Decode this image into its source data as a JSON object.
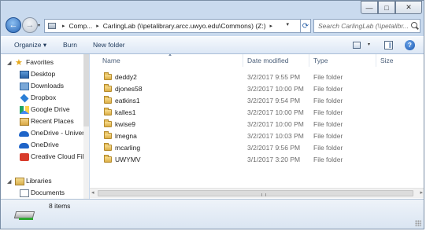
{
  "window": {
    "minimize_glyph": "—",
    "maximize_glyph": "□",
    "close_glyph": "✕"
  },
  "navigation": {
    "back_glyph": "←",
    "forward_glyph": "→",
    "address_segments": [
      "Comp...",
      "CarlingLab (\\\\petalibrary.arcc.uwyo.edu\\Commons) (Z:)"
    ],
    "separator": "▸",
    "search_placeholder": "Search CarlingLab (\\\\petalibr..."
  },
  "toolbar": {
    "organize_label": "Organize ▾",
    "burn_label": "Burn",
    "new_folder_label": "New folder",
    "help_glyph": "?"
  },
  "sidebar": {
    "items": [
      {
        "label": "Favorites",
        "icon": "star-icon"
      },
      {
        "label": "Desktop",
        "icon": "desktop-icon"
      },
      {
        "label": "Downloads",
        "icon": "downloads-icon"
      },
      {
        "label": "Dropbox",
        "icon": "dropbox-icon"
      },
      {
        "label": "Google Drive",
        "icon": "google-drive-icon"
      },
      {
        "label": "Recent Places",
        "icon": "recent-places-icon"
      },
      {
        "label": "OneDrive - Univer",
        "icon": "onedrive-icon"
      },
      {
        "label": "OneDrive",
        "icon": "onedrive-icon"
      },
      {
        "label": "Creative Cloud Fil",
        "icon": "creative-cloud-icon"
      },
      {
        "label": "Libraries",
        "icon": "libraries-icon"
      },
      {
        "label": "Documents",
        "icon": "documents-icon"
      }
    ]
  },
  "columns": {
    "name": "Name",
    "date_modified": "Date modified",
    "type": "Type",
    "size": "Size"
  },
  "files": [
    {
      "name": "deddy2",
      "date": "3/2/2017 9:55 PM",
      "type": "File folder"
    },
    {
      "name": "djones58",
      "date": "3/2/2017 10:00 PM",
      "type": "File folder"
    },
    {
      "name": "eatkins1",
      "date": "3/2/2017 9:54 PM",
      "type": "File folder"
    },
    {
      "name": "kalles1",
      "date": "3/2/2017 10:00 PM",
      "type": "File folder"
    },
    {
      "name": "kwise9",
      "date": "3/2/2017 10:00 PM",
      "type": "File folder"
    },
    {
      "name": "lmegna",
      "date": "3/2/2017 10:03 PM",
      "type": "File folder"
    },
    {
      "name": "mcarling",
      "date": "3/2/2017 9:56 PM",
      "type": "File folder"
    },
    {
      "name": "UWYMV",
      "date": "3/1/2017 3:20 PM",
      "type": "File folder"
    }
  ],
  "status": {
    "item_count": "8 items"
  }
}
